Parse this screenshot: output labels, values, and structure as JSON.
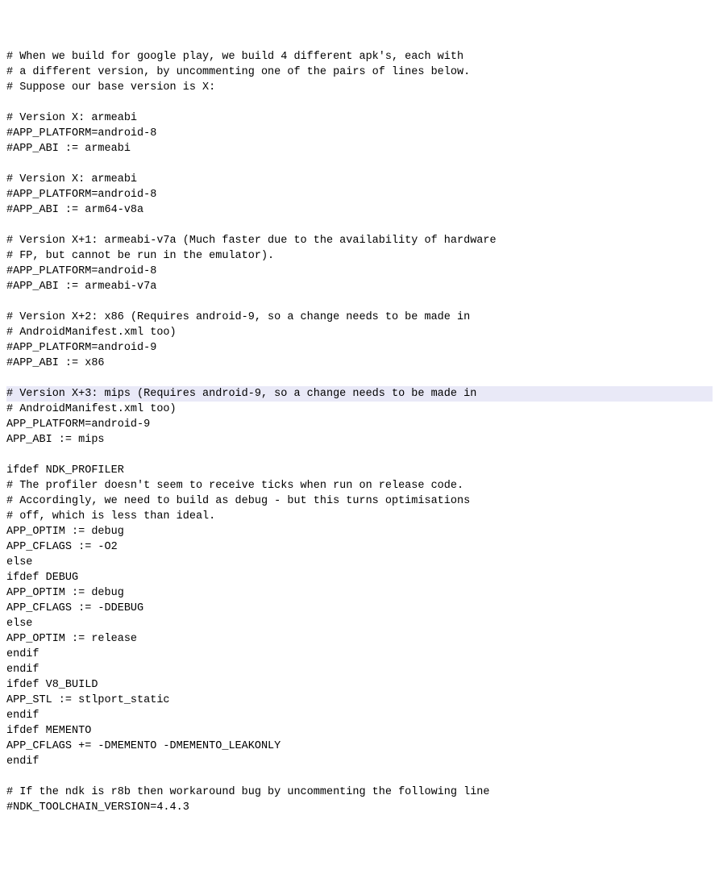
{
  "lines": [
    {
      "text": "# When we build for google play, we build 4 different apk's, each with",
      "hl": false
    },
    {
      "text": "# a different version, by uncommenting one of the pairs of lines below.",
      "hl": false
    },
    {
      "text": "# Suppose our base version is X:",
      "hl": false
    },
    {
      "text": "",
      "hl": false
    },
    {
      "text": "# Version X: armeabi",
      "hl": false
    },
    {
      "text": "#APP_PLATFORM=android-8",
      "hl": false
    },
    {
      "text": "#APP_ABI := armeabi",
      "hl": false
    },
    {
      "text": "",
      "hl": false
    },
    {
      "text": "# Version X: armeabi",
      "hl": false
    },
    {
      "text": "#APP_PLATFORM=android-8",
      "hl": false
    },
    {
      "text": "#APP_ABI := arm64-v8a",
      "hl": false
    },
    {
      "text": "",
      "hl": false
    },
    {
      "text": "# Version X+1: armeabi-v7a (Much faster due to the availability of hardware",
      "hl": false
    },
    {
      "text": "# FP, but cannot be run in the emulator).",
      "hl": false
    },
    {
      "text": "#APP_PLATFORM=android-8",
      "hl": false
    },
    {
      "text": "#APP_ABI := armeabi-v7a",
      "hl": false
    },
    {
      "text": "",
      "hl": false
    },
    {
      "text": "# Version X+2: x86 (Requires android-9, so a change needs to be made in",
      "hl": false
    },
    {
      "text": "# AndroidManifest.xml too)",
      "hl": false
    },
    {
      "text": "#APP_PLATFORM=android-9",
      "hl": false
    },
    {
      "text": "#APP_ABI := x86",
      "hl": false
    },
    {
      "text": "",
      "hl": false
    },
    {
      "text": "# Version X+3: mips (Requires android-9, so a change needs to be made in",
      "hl": true
    },
    {
      "text": "# AndroidManifest.xml too)",
      "hl": false
    },
    {
      "text": "APP_PLATFORM=android-9",
      "hl": false
    },
    {
      "text": "APP_ABI := mips",
      "hl": false
    },
    {
      "text": "",
      "hl": false
    },
    {
      "text": "ifdef NDK_PROFILER",
      "hl": false
    },
    {
      "text": "# The profiler doesn't seem to receive ticks when run on release code.",
      "hl": false
    },
    {
      "text": "# Accordingly, we need to build as debug - but this turns optimisations",
      "hl": false
    },
    {
      "text": "# off, which is less than ideal.",
      "hl": false
    },
    {
      "text": "APP_OPTIM := debug",
      "hl": false
    },
    {
      "text": "APP_CFLAGS := -O2",
      "hl": false
    },
    {
      "text": "else",
      "hl": false
    },
    {
      "text": "ifdef DEBUG",
      "hl": false
    },
    {
      "text": "APP_OPTIM := debug",
      "hl": false
    },
    {
      "text": "APP_CFLAGS := -DDEBUG",
      "hl": false
    },
    {
      "text": "else",
      "hl": false
    },
    {
      "text": "APP_OPTIM := release",
      "hl": false
    },
    {
      "text": "endif",
      "hl": false
    },
    {
      "text": "endif",
      "hl": false
    },
    {
      "text": "ifdef V8_BUILD",
      "hl": false
    },
    {
      "text": "APP_STL := stlport_static",
      "hl": false
    },
    {
      "text": "endif",
      "hl": false
    },
    {
      "text": "ifdef MEMENTO",
      "hl": false
    },
    {
      "text": "APP_CFLAGS += -DMEMENTO -DMEMENTO_LEAKONLY",
      "hl": false
    },
    {
      "text": "endif",
      "hl": false
    },
    {
      "text": "",
      "hl": false
    },
    {
      "text": "# If the ndk is r8b then workaround bug by uncommenting the following line",
      "hl": false
    },
    {
      "text": "#NDK_TOOLCHAIN_VERSION=4.4.3",
      "hl": false
    }
  ]
}
